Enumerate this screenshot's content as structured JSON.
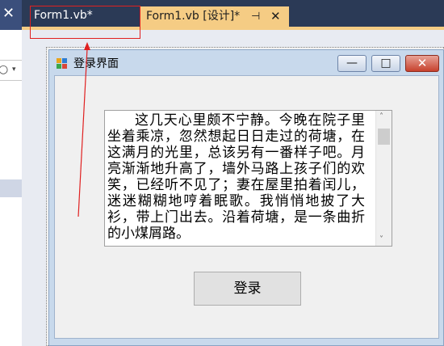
{
  "left_panel": {
    "close_glyph": "✕",
    "combo_glyph": "○",
    "combo_caret": "▾"
  },
  "tabs": [
    {
      "label": "Form1.vb*"
    },
    {
      "label": "Form1.vb [设计]*",
      "pin_glyph": "⊣",
      "close_glyph": "✕"
    }
  ],
  "form": {
    "title": "登录界面",
    "min_glyph": "—",
    "max_glyph": "□",
    "close_glyph": "✕",
    "textbox_text": "这几天心里颇不宁静。今晚在院子里坐着乘凉，忽然想起日日走过的荷塘，在这满月的光里，总该另有一番样子吧。月亮渐渐地升高了，墙外马路上孩子们的欢笑，已经听不见了；妻在屋里拍着闰儿，迷迷糊糊地哼着眠歌。我悄悄地披了大衫，带上门出去。沿着荷塘，是一条曲折的小煤屑路。",
    "scroll_up": "˄",
    "scroll_down": "˅",
    "login_label": "登录"
  },
  "colors": {
    "tab_active": "#f5cc84",
    "chrome_dark": "#2b3a56",
    "annotation": "#e02020"
  }
}
